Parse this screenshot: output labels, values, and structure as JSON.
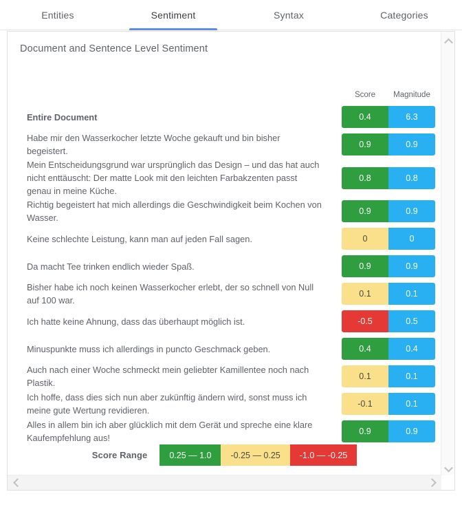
{
  "tabs": [
    {
      "label": "Entities",
      "active": false
    },
    {
      "label": "Sentiment",
      "active": true
    },
    {
      "label": "Syntax",
      "active": false
    },
    {
      "label": "Categories",
      "active": false
    }
  ],
  "panel": {
    "title": "Document and Sentence Level Sentiment",
    "columns": {
      "score": "Score",
      "magnitude": "Magnitude"
    }
  },
  "rows": [
    {
      "text": "Entire Document",
      "score": "0.4",
      "magnitude": "6.3",
      "tone": "pos",
      "is_document": true
    },
    {
      "text": "Habe mir den Wasserkocher letzte Woche gekauft und bin bisher begeistert.",
      "score": "0.9",
      "magnitude": "0.9",
      "tone": "pos",
      "is_document": false
    },
    {
      "text": "Mein Entscheidungsgrund war ursprünglich das Design – und das hat auch nicht enttäuscht: Der matte Look mit den leichten Farbakzenten passt genau in meine Küche.",
      "score": "0.8",
      "magnitude": "0.8",
      "tone": "pos",
      "is_document": false
    },
    {
      "text": "Richtig begeistert hat mich allerdings die Geschwindigkeit beim Kochen von Wasser.",
      "score": "0.9",
      "magnitude": "0.9",
      "tone": "pos",
      "is_document": false
    },
    {
      "text": "Keine schlechte Leistung, kann man auf jeden Fall sagen.",
      "score": "0",
      "magnitude": "0",
      "tone": "neu",
      "is_document": false
    },
    {
      "text": "Da macht Tee trinken endlich wieder Spaß.",
      "score": "0.9",
      "magnitude": "0.9",
      "tone": "pos",
      "is_document": false
    },
    {
      "text": "Bisher habe ich noch keinen Wasserkocher erlebt, der so schnell von Null auf 100 war.",
      "score": "0.1",
      "magnitude": "0.1",
      "tone": "neu",
      "is_document": false
    },
    {
      "text": "Ich hatte keine Ahnung, dass das überhaupt möglich ist.",
      "score": "-0.5",
      "magnitude": "0.5",
      "tone": "neg",
      "is_document": false
    },
    {
      "text": "Minuspunkte muss ich allerdings in puncto Geschmack geben.",
      "score": "0.4",
      "magnitude": "0.4",
      "tone": "pos",
      "is_document": false
    },
    {
      "text": "Auch nach einer Woche schmeckt mein geliebter Kamillentee noch nach Plastik.",
      "score": "0.1",
      "magnitude": "0.1",
      "tone": "neu",
      "is_document": false
    },
    {
      "text": "Ich hoffe, dass dies sich nun aber zukünftig ändern wird, sonst muss ich meine gute Wertung revidieren.",
      "score": "-0.1",
      "magnitude": "0.1",
      "tone": "neu",
      "is_document": false
    },
    {
      "text": "Alles in allem bin ich aber glücklich mit dem Gerät und spreche eine klare Kaufempfehlung aus!",
      "score": "0.9",
      "magnitude": "0.9",
      "tone": "pos",
      "is_document": false
    }
  ],
  "legend": {
    "label": "Score Range",
    "segments": [
      {
        "text": "0.25 — 1.0",
        "tone": "green"
      },
      {
        "text": "-0.25 — 0.25",
        "tone": "yellow"
      },
      {
        "text": "-1.0 — -0.25",
        "tone": "red"
      }
    ]
  },
  "scrollbars": {
    "vertical": {
      "up_icon": "chevron-up-icon",
      "down_icon": "chevron-down-icon"
    },
    "horizontal": {
      "left_icon": "chevron-left-icon",
      "right_icon": "chevron-right-icon"
    }
  },
  "colors": {
    "positive": "#2e9e3e",
    "neutral": "#fbe08c",
    "negative": "#e53935",
    "magnitude": "#29b0f2",
    "accent": "#5b8bef"
  }
}
